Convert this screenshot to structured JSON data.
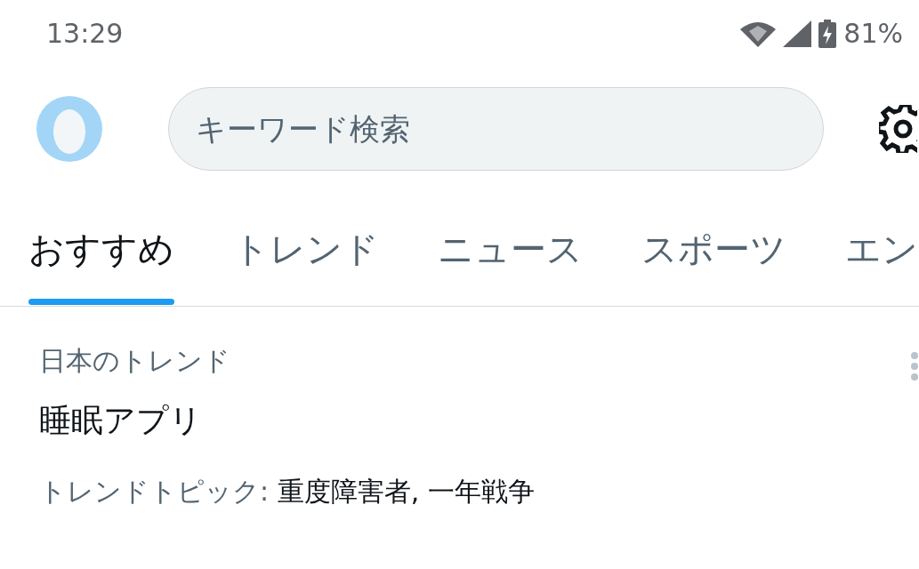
{
  "status_bar": {
    "time": "13:29",
    "battery": "81%"
  },
  "search": {
    "placeholder": "キーワード検索"
  },
  "tabs": [
    {
      "label": "おすすめ",
      "selected": true
    },
    {
      "label": "トレンド",
      "selected": false
    },
    {
      "label": "ニュース",
      "selected": false
    },
    {
      "label": "スポーツ",
      "selected": false
    },
    {
      "label": "エン",
      "selected": false
    }
  ],
  "trends": [
    {
      "context": "日本のトレンド",
      "title": "睡眠アプリ",
      "topics_label": "トレンドトピック:",
      "topics": "重度障害者, 一年戦争"
    }
  ]
}
